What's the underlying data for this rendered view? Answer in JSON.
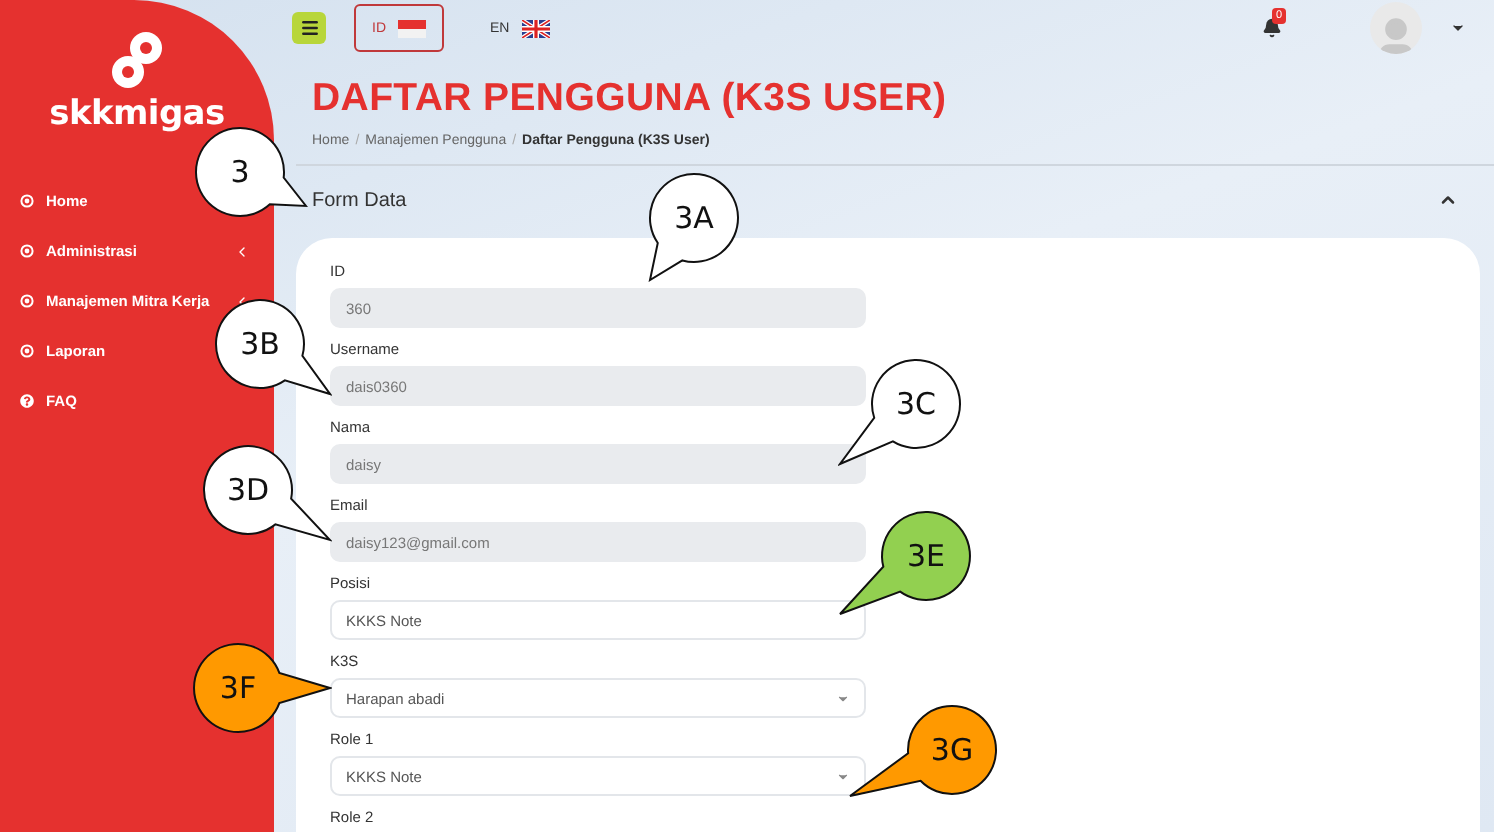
{
  "sidebar": {
    "brand": "skkmigas",
    "items": [
      {
        "label": "Home",
        "kind": "circle",
        "has_submenu": false
      },
      {
        "label": "Administrasi",
        "kind": "circle",
        "has_submenu": true
      },
      {
        "label": "Manajemen Mitra Kerja",
        "kind": "circle",
        "has_submenu": true
      },
      {
        "label": "Laporan",
        "kind": "circle",
        "has_submenu": false
      },
      {
        "label": "FAQ",
        "kind": "help",
        "has_submenu": false
      }
    ]
  },
  "topbar": {
    "languages": [
      {
        "code": "ID",
        "kind": "indonesia",
        "selected": true
      },
      {
        "code": "EN",
        "kind": "uk",
        "selected": false
      }
    ],
    "notification_count": "0"
  },
  "page": {
    "title": "DAFTAR PENGGUNA (K3S USER)",
    "breadcrumb": [
      {
        "label": "Home",
        "current": false
      },
      {
        "label": "Manajemen Pengguna",
        "current": false,
        "separator": "/"
      },
      {
        "label": "Daftar Pengguna (K3S User)",
        "current": true,
        "separator": "/"
      }
    ],
    "section": {
      "title": "Form Data",
      "expanded": true
    }
  },
  "form": {
    "fields": [
      {
        "label": "ID",
        "value": "360",
        "kind": "readonly"
      },
      {
        "label": "Username",
        "value": "dais0360",
        "kind": "readonly"
      },
      {
        "label": "Nama",
        "value": "daisy",
        "kind": "readonly"
      },
      {
        "label": "Email",
        "value": "daisy123@gmail.com",
        "kind": "readonly"
      },
      {
        "label": "Posisi",
        "value": "KKKS Note",
        "kind": "text"
      },
      {
        "label": "K3S",
        "value": "Harapan abadi",
        "kind": "select"
      },
      {
        "label": "Role 1",
        "value": "KKKS Note",
        "kind": "select"
      },
      {
        "label": "Role 2",
        "kind": "label"
      }
    ]
  },
  "callouts": [
    {
      "label": "3",
      "color": "#ffffff"
    },
    {
      "label": "3A",
      "color": "#ffffff"
    },
    {
      "label": "3B",
      "color": "#ffffff"
    },
    {
      "label": "3C",
      "color": "#ffffff"
    },
    {
      "label": "3D",
      "color": "#ffffff"
    },
    {
      "label": "3E",
      "color": "#92d050"
    },
    {
      "label": "3F",
      "color": "#ff9900"
    },
    {
      "label": "3G",
      "color": "#ff9900"
    }
  ]
}
